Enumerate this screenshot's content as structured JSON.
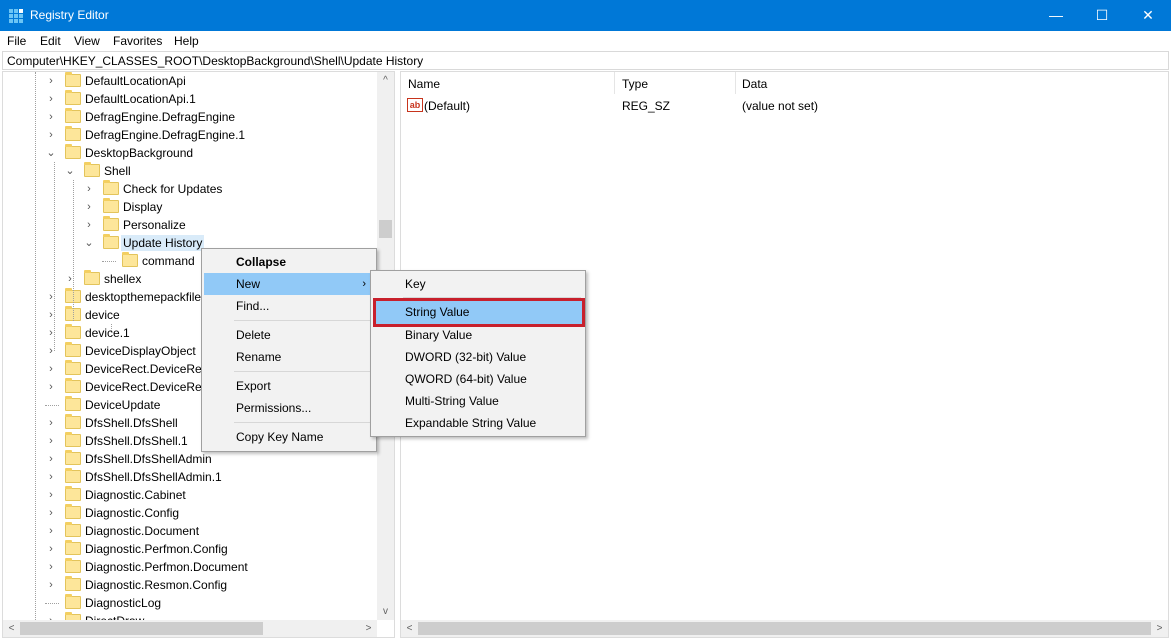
{
  "window": {
    "title": "Registry Editor",
    "controls": {
      "minimize": "—",
      "maximize": "☐",
      "close": "✕"
    }
  },
  "menubar": [
    "File",
    "Edit",
    "View",
    "Favorites",
    "Help"
  ],
  "address": "Computer\\HKEY_CLASSES_ROOT\\DesktopBackground\\Shell\\Update History",
  "tree": [
    {
      "label": "DefaultLocationApi",
      "expander": ">"
    },
    {
      "label": "DefaultLocationApi.1",
      "expander": ">"
    },
    {
      "label": "DefragEngine.DefragEngine",
      "expander": ">"
    },
    {
      "label": "DefragEngine.DefragEngine.1",
      "expander": ">"
    },
    {
      "label": "DesktopBackground",
      "expander": "v"
    },
    {
      "label": "Shell",
      "expander": "v"
    },
    {
      "label": "Check for Updates",
      "expander": ">"
    },
    {
      "label": "Display",
      "expander": ">"
    },
    {
      "label": "Personalize",
      "expander": ">"
    },
    {
      "label": "Update History",
      "expander": "v",
      "selected": true
    },
    {
      "label": "command",
      "expander": ""
    },
    {
      "label": "shellex",
      "expander": ">"
    },
    {
      "label": "desktopthemepackfile",
      "expander": ">"
    },
    {
      "label": "device",
      "expander": ">"
    },
    {
      "label": "device.1",
      "expander": ">"
    },
    {
      "label": "DeviceDisplayObject",
      "expander": ">"
    },
    {
      "label": "DeviceRect.DeviceRect",
      "expander": ">"
    },
    {
      "label": "DeviceRect.DeviceRect",
      "expander": ">"
    },
    {
      "label": "DeviceUpdate",
      "expander": ""
    },
    {
      "label": "DfsShell.DfsShell",
      "expander": ">"
    },
    {
      "label": "DfsShell.DfsShell.1",
      "expander": ">"
    },
    {
      "label": "DfsShell.DfsShellAdmin",
      "expander": ">"
    },
    {
      "label": "DfsShell.DfsShellAdmin.1",
      "expander": ">"
    },
    {
      "label": "Diagnostic.Cabinet",
      "expander": ">"
    },
    {
      "label": "Diagnostic.Config",
      "expander": ">"
    },
    {
      "label": "Diagnostic.Document",
      "expander": ">"
    },
    {
      "label": "Diagnostic.Perfmon.Config",
      "expander": ">"
    },
    {
      "label": "Diagnostic.Perfmon.Document",
      "expander": ">"
    },
    {
      "label": "Diagnostic.Resmon.Config",
      "expander": ">"
    },
    {
      "label": "DiagnosticLog",
      "expander": ""
    },
    {
      "label": "DirectDraw",
      "expander": ">"
    }
  ],
  "list": {
    "headers": {
      "name": "Name",
      "type": "Type",
      "data": "Data"
    },
    "rows": [
      {
        "icon": "ab",
        "name": "(Default)",
        "type": "REG_SZ",
        "data": "(value not set)"
      }
    ]
  },
  "context_menu": {
    "items": [
      {
        "label": "Collapse",
        "bold": true
      },
      {
        "label": "New",
        "submenu": true,
        "highlighted": true
      },
      {
        "label": "Find..."
      },
      {
        "label": "Delete"
      },
      {
        "label": "Rename"
      },
      {
        "label": "Export"
      },
      {
        "label": "Permissions..."
      },
      {
        "label": "Copy Key Name"
      }
    ],
    "submenu_arrow": "›"
  },
  "new_submenu": {
    "items": [
      {
        "label": "Key"
      },
      {
        "label": "String Value",
        "highlighted": true
      },
      {
        "label": "Binary Value"
      },
      {
        "label": "DWORD (32-bit) Value"
      },
      {
        "label": "QWORD (64-bit) Value"
      },
      {
        "label": "Multi-String Value"
      },
      {
        "label": "Expandable String Value"
      }
    ]
  },
  "scroll_arrows": {
    "up": "^",
    "down": "v",
    "left": "<",
    "right": ">"
  },
  "colors": {
    "titlebar": "#0078d7",
    "highlight": "#91c9f7",
    "callout": "#c8202c"
  }
}
